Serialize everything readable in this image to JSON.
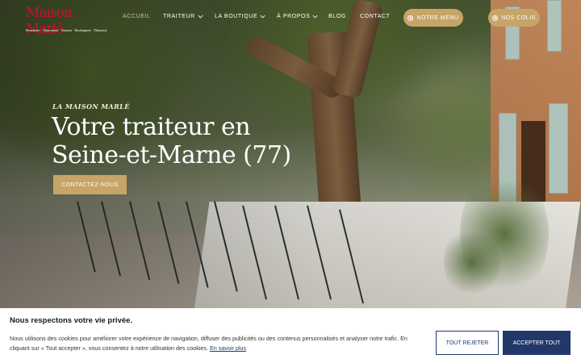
{
  "brand": {
    "logo_text": "Maison Marlé",
    "logo_tagline": "Boucherie · Charcuterie · Traiteur · Boulangerie · Pâtisserie"
  },
  "nav": {
    "items": [
      {
        "label": "ACCUEIL",
        "active": true
      },
      {
        "label": "TRAITEUR",
        "has_dropdown": true
      },
      {
        "label": "LA BOUTIQUE",
        "has_dropdown": true
      },
      {
        "label": "À PROPOS",
        "has_dropdown": true
      },
      {
        "label": "BLOG"
      },
      {
        "label": "CONTACT"
      }
    ],
    "menu_button": "NOTRE MENU",
    "parcels_button": "NOS COLIS"
  },
  "hero": {
    "kicker": "LA MAISON MARLÉ",
    "headline_line1": "Votre traiteur en",
    "headline_line2": "Seine-et-Marne (77)",
    "cta_label": "CONTACTEZ-NOUS"
  },
  "cookie": {
    "title": "Nous respectons votre vie privée.",
    "text": "Nous utilisons des cookies pour améliorer votre expérience de navigation, diffuser des publicités ou des contenus personnalisés et analyser notre trafic. En cliquant sur « Tout accepter », vous consentez à notre utilisation des cookies.",
    "link": "En savoir plus",
    "reject_label": "TOUT REJETER",
    "accept_label": "ACCEPTER TOUT"
  },
  "colors": {
    "accent_gold": "#c7a467",
    "logo_red": "#c8102e",
    "navy": "#22386a"
  }
}
